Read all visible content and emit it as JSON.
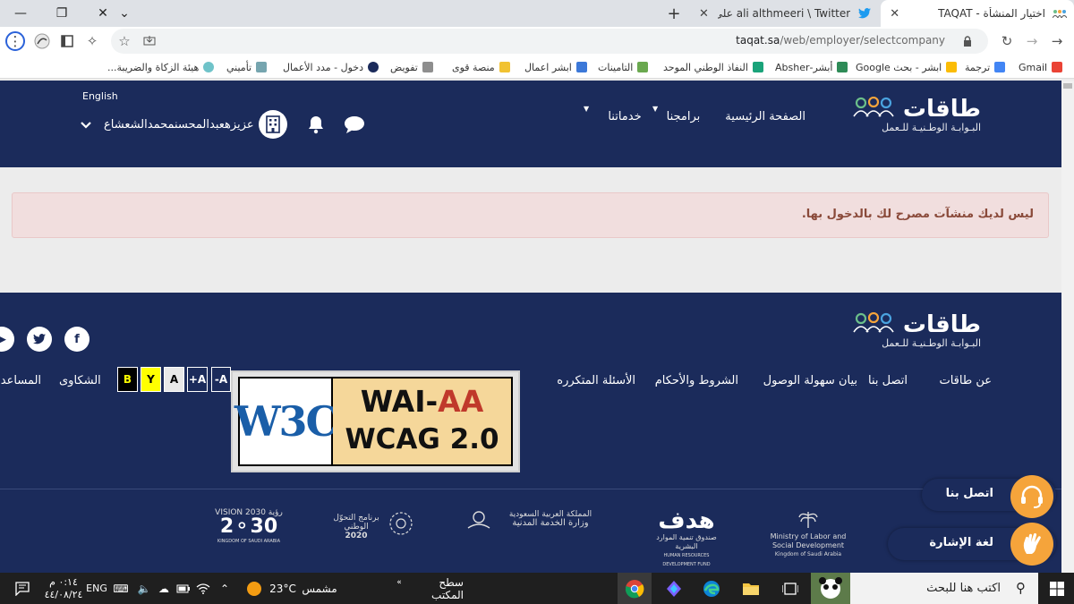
{
  "browser": {
    "tabs": [
      {
        "title": "اختيار المنشأة - TAQAT",
        "active": true
      },
      {
        "title": "ali althmeeri \\ Twitter على تويتر: \"...",
        "active": false
      }
    ],
    "url_host": "taqat.sa",
    "url_path": "/web/employer/selectcompany",
    "bookmarks": [
      "Gmail",
      "ترجمة",
      "ابشر - بحث Google",
      "أبشر-Absher",
      "النفاذ الوطني الموحد",
      "التامينات",
      "ابشر اعمال",
      "منصة قوى",
      "تفويض",
      "دخول - مدد الأعمال",
      "تأميني",
      "هيئة الزكاة والضريبة..."
    ]
  },
  "header": {
    "logo_main": "طاقات",
    "logo_sub": "البـوابـة الوطـنيـة للـعمل",
    "nav": [
      "الصفحة الرئيسية",
      "برامجنا",
      "خدماتنا"
    ],
    "language": "English",
    "user_name": "عزيزهعبدالمحسنمحمدالشعشاع"
  },
  "alert": {
    "message": "ليس لديك منشآت مصرح لك بالدخول بها."
  },
  "footer": {
    "logo_main": "طاقات",
    "logo_sub": "البـوابـة الوطـنيـة للـعمل",
    "links": [
      "عن طاقات",
      "اتصل بنا",
      "بيان سهولة الوصول",
      "الشروط والأحكام",
      "الأسئلة المتكرره",
      "الشكاوى",
      "المساعدة"
    ],
    "access": {
      "contrast_b": "B",
      "contrast_y": "Y",
      "contrast_a": "A",
      "font_plus": "+A",
      "font_minus": "-A"
    },
    "w3c_badge": {
      "logo": "W3C",
      "line1_a": "WAI-",
      "line1_b": "AA",
      "line2": "WCAG 2.0"
    },
    "partners": [
      {
        "name": "Ministry of Labor and Social Development",
        "sub": "Kingdom of Saudi Arabia"
      },
      {
        "name": "صندوق تنمية الموارد البشرية",
        "sub": "HUMAN RESOURCES DEVELOPMENT FUND"
      },
      {
        "name": "المملكة العربية السعودية",
        "sub": "وزارة الخدمة المدنية"
      },
      {
        "name": "برنامج التحوّل الوطني",
        "sub": "2020"
      },
      {
        "name": "رؤية VISION 2030",
        "sub": "KINGDOM OF SAUDI ARABIA"
      }
    ],
    "contact_btn": "اتصل بنا",
    "sign_btn": "لغة الإشارة"
  },
  "taskbar": {
    "search_placeholder": "اكتب هنا للبحث",
    "desktop_label": "سطح المكتب",
    "weather_temp": "23°C",
    "weather_desc": "مشمس",
    "lang": "ENG",
    "time": "٠:١٤ م",
    "date": "٤٤/٠٨/٢٤"
  },
  "colors": {
    "brand_navy": "#1b2b5b",
    "alert_bg": "#f1dede",
    "alert_text": "#8a4a3a",
    "float_accent": "#f5a43b"
  }
}
